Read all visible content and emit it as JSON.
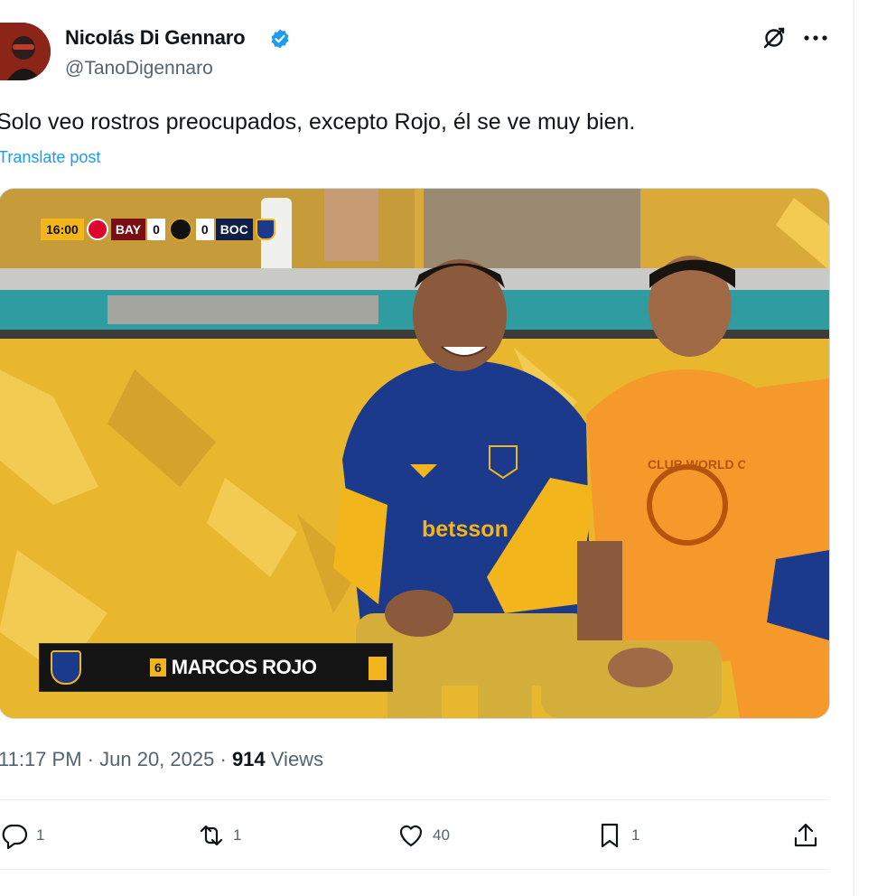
{
  "author": {
    "name": "Nicolás Di Gennaro",
    "handle": "@TanoDigennaro",
    "verified": true,
    "verified_color": "#1d9bf0"
  },
  "header_icons": [
    "grok-icon",
    "more-options-icon"
  ],
  "post": {
    "text": "Solo veo rostros preocupados, excepto Rojo, él se ve muy bien.",
    "translate_label": "Translate post"
  },
  "media": {
    "scoreboard": {
      "clock": "16:00",
      "home": "BAY",
      "home_score": "0",
      "away_score": "0",
      "away": "BOC"
    },
    "player_caption": {
      "number": "6",
      "name": "MARCOS ROJO"
    },
    "jersey_sponsor": "betsson",
    "bib_text": "CLUB WORLD CUP"
  },
  "meta": {
    "time": "11:17 PM",
    "dot1": "·",
    "date": "Jun 20, 2025",
    "dot2": "·",
    "views": "914",
    "views_label": "Views"
  },
  "actions": {
    "replies": "1",
    "reposts": "1",
    "likes": "40",
    "bookmarks": "1"
  },
  "colors": {
    "accent": "#1d9bf0",
    "secondary_text": "#536471",
    "boca_blue": "#1b3a8c",
    "boca_yellow": "#f2b51c"
  }
}
